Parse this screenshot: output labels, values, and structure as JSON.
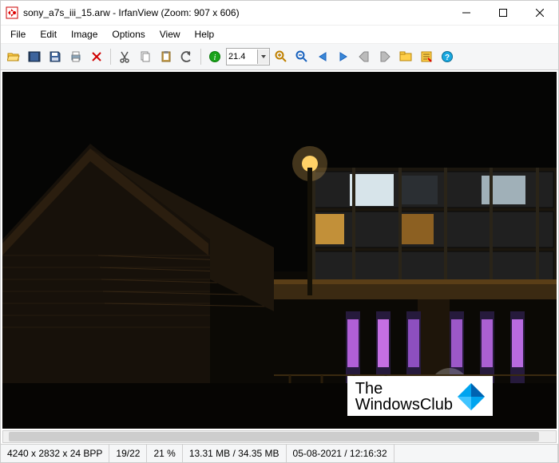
{
  "title": "sony_a7s_iii_15.arw - IrfanView (Zoom: 907 x 606)",
  "menu": {
    "items": [
      "File",
      "Edit",
      "Image",
      "Options",
      "View",
      "Help"
    ]
  },
  "toolbar": {
    "zoom_value": "21.4"
  },
  "watermark": {
    "line1": "The",
    "line2": "WindowsClub"
  },
  "status": {
    "dimensions": "4240 x 2832 x 24 BPP",
    "index": "19/22",
    "zoom_percent": "21 %",
    "size": "13.31 MB / 34.35 MB",
    "datetime": "05-08-2021 / 12:16:32"
  }
}
